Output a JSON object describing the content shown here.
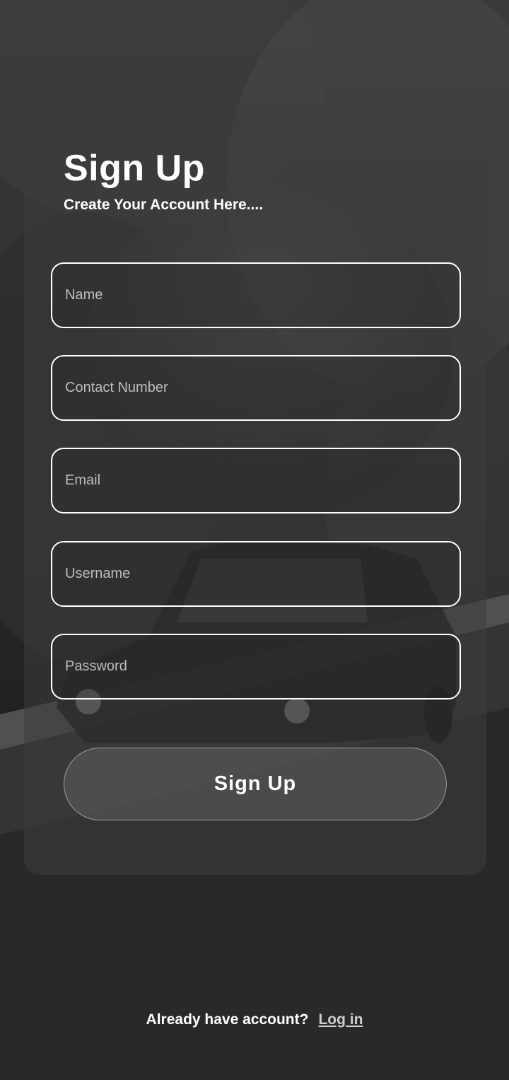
{
  "page": {
    "title": "Sign Up",
    "subtitle": "Create Your Account Here...."
  },
  "form": {
    "name_placeholder": "Name",
    "contact_placeholder": "Contact Number",
    "email_placeholder": "Email",
    "username_placeholder": "Username",
    "password_placeholder": "Password",
    "submit_label": "Sign Up"
  },
  "footer": {
    "prompt": "Already have account?",
    "login_label": "Log in"
  },
  "colors": {
    "text": "#ffffff",
    "field_border": "#ffffff",
    "placeholder": "#bdbdbd",
    "link": "#cfcfcf"
  }
}
